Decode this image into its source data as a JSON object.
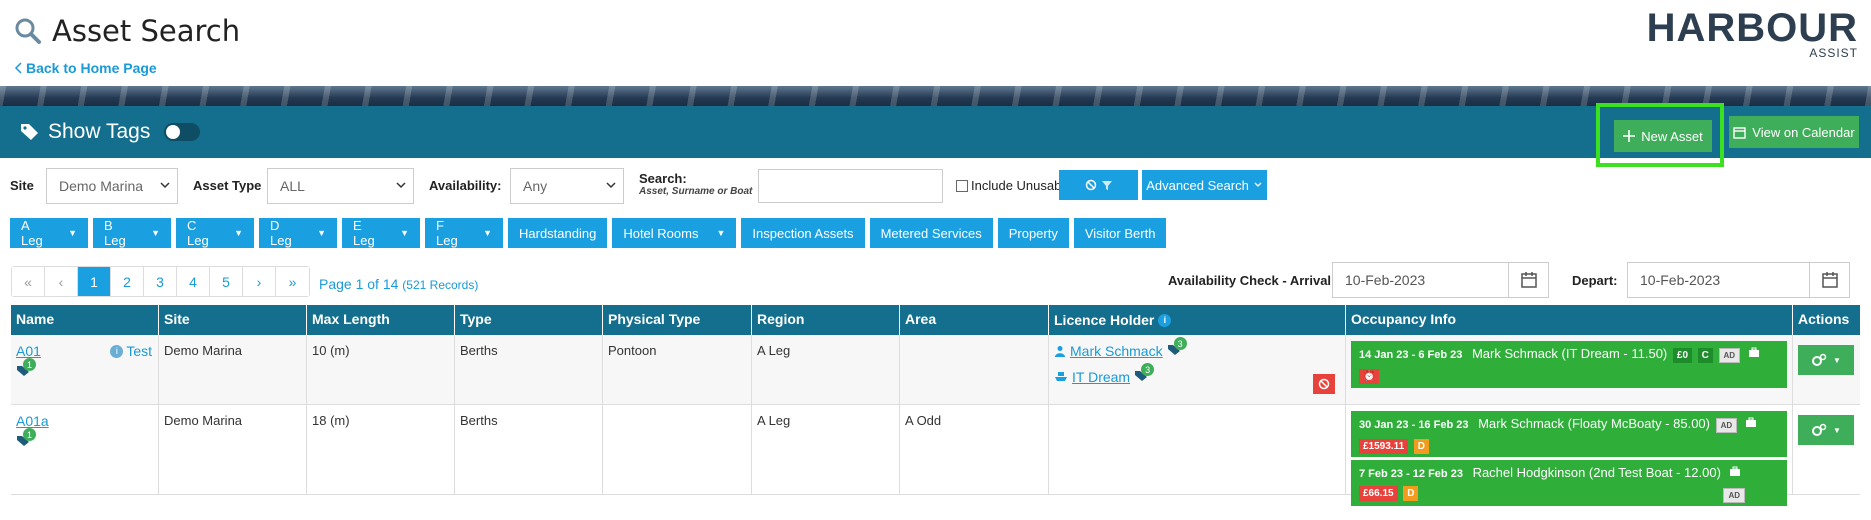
{
  "header": {
    "title": "Asset Search",
    "back_link": "Back to Home Page",
    "logo_main": "HARBOUR",
    "logo_sub": "ASSIST"
  },
  "toolbar": {
    "show_tags": "Show Tags",
    "new_asset": "New Asset",
    "view_calendar": "View on Calendar"
  },
  "filters": {
    "site_label": "Site",
    "site_value": "Demo Marina",
    "asset_type_label": "Asset Type",
    "asset_type_value": "ALL",
    "availability_label": "Availability:",
    "availability_value": "Any",
    "search_label": "Search:",
    "search_hint": "Asset, Surname or Boat",
    "search_value": "",
    "include_unusable": "Include Unusable",
    "advanced_search": "Advanced Search"
  },
  "tag_buttons": [
    {
      "label": "A Leg",
      "caret": true
    },
    {
      "label": "B Leg",
      "caret": true
    },
    {
      "label": "C Leg",
      "caret": true
    },
    {
      "label": "D Leg",
      "caret": true
    },
    {
      "label": "E Leg",
      "caret": true
    },
    {
      "label": "F Leg",
      "caret": true
    },
    {
      "label": "Hardstanding",
      "caret": false
    },
    {
      "label": "Hotel Rooms",
      "caret": true
    },
    {
      "label": "Inspection Assets",
      "caret": false
    },
    {
      "label": "Metered Services",
      "caret": false
    },
    {
      "label": "Property",
      "caret": false
    },
    {
      "label": "Visitor Berth",
      "caret": false
    }
  ],
  "pagination": {
    "items": [
      "«",
      "‹",
      "1",
      "2",
      "3",
      "4",
      "5",
      "›",
      "»"
    ],
    "page_info": "Page 1 of 14",
    "records": "(521 Records)"
  },
  "availability": {
    "arrival_label": "Availability Check - Arrival:",
    "arrival_value": "10-Feb-2023",
    "depart_label": "Depart:",
    "depart_value": "10-Feb-2023"
  },
  "table": {
    "columns": [
      "Name",
      "Site",
      "Max Length",
      "Type",
      "Physical Type",
      "Region",
      "Area",
      "Licence Holder",
      "Occupancy Info",
      "Actions"
    ],
    "rows": [
      {
        "name": "A01",
        "name_note": "Test",
        "tag_count": "1",
        "site": "Demo Marina",
        "max_length": "10 (m)",
        "type": "Berths",
        "physical_type": "Pontoon",
        "region": "A Leg",
        "area": "",
        "holders": [
          {
            "name": "Mark Schmack",
            "count": "3"
          },
          {
            "name": "IT Dream",
            "count": "3"
          }
        ],
        "occupancy": [
          {
            "dates": "14 Jan 23 - 6 Feb 23",
            "who": "Mark Schmack (IT Dream - 11.50)",
            "chip1": "£0",
            "chip2": "C",
            "chip3": "AD"
          }
        ]
      },
      {
        "name": "A01a",
        "tag_count": "1",
        "site": "Demo Marina",
        "max_length": "18 (m)",
        "type": "Berths",
        "physical_type": "",
        "region": "A Leg",
        "area": "A Odd",
        "occupancy": [
          {
            "dates": "30 Jan 23 - 16 Feb 23",
            "who": "Mark Schmack (Floaty McBoaty - 85.00)",
            "chip_ad": "AD",
            "amount": "£1593.11",
            "flag": "D"
          },
          {
            "dates": "7 Feb 23 - 12 Feb 23",
            "who": "Rachel Hodgkinson (2nd Test Boat - 12.00)",
            "chip_ad": "AD",
            "amount": "£66.15",
            "flag": "D"
          }
        ]
      }
    ]
  }
}
